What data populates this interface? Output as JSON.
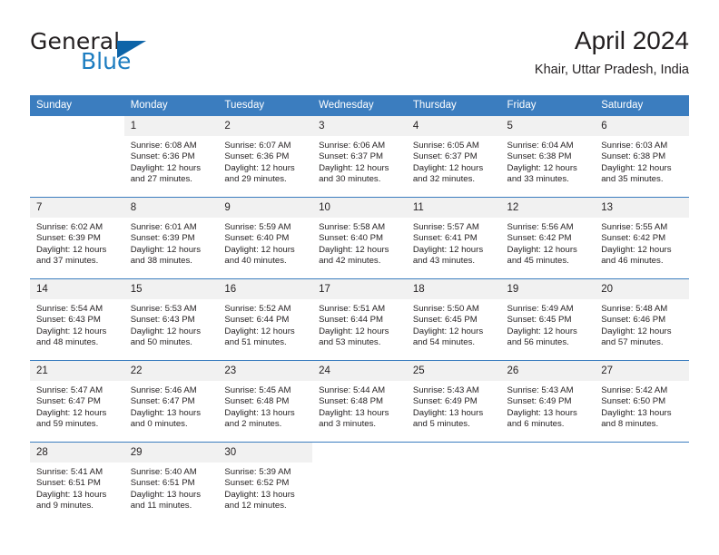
{
  "brand": {
    "name_part1": "General",
    "name_part2": "Blue",
    "triangle_color": "#0d64a8",
    "blue_color": "#1c7cc0"
  },
  "header": {
    "title": "April 2024",
    "subtitle": "Khair, Uttar Pradesh, India"
  },
  "theme": {
    "header_bg": "#3b7dbf",
    "header_text": "#ffffff",
    "daynum_bg": "#f1f1f1",
    "cell_bg": "#ffffff",
    "text": "#231f20"
  },
  "calendar": {
    "weekdays": [
      "Sunday",
      "Monday",
      "Tuesday",
      "Wednesday",
      "Thursday",
      "Friday",
      "Saturday"
    ],
    "weeks": [
      [
        {
          "blank": true
        },
        {
          "day": "1",
          "sunrise": "Sunrise: 6:08 AM",
          "sunset": "Sunset: 6:36 PM",
          "daylight_line1": "Daylight: 12 hours",
          "daylight_line2": "and 27 minutes."
        },
        {
          "day": "2",
          "sunrise": "Sunrise: 6:07 AM",
          "sunset": "Sunset: 6:36 PM",
          "daylight_line1": "Daylight: 12 hours",
          "daylight_line2": "and 29 minutes."
        },
        {
          "day": "3",
          "sunrise": "Sunrise: 6:06 AM",
          "sunset": "Sunset: 6:37 PM",
          "daylight_line1": "Daylight: 12 hours",
          "daylight_line2": "and 30 minutes."
        },
        {
          "day": "4",
          "sunrise": "Sunrise: 6:05 AM",
          "sunset": "Sunset: 6:37 PM",
          "daylight_line1": "Daylight: 12 hours",
          "daylight_line2": "and 32 minutes."
        },
        {
          "day": "5",
          "sunrise": "Sunrise: 6:04 AM",
          "sunset": "Sunset: 6:38 PM",
          "daylight_line1": "Daylight: 12 hours",
          "daylight_line2": "and 33 minutes."
        },
        {
          "day": "6",
          "sunrise": "Sunrise: 6:03 AM",
          "sunset": "Sunset: 6:38 PM",
          "daylight_line1": "Daylight: 12 hours",
          "daylight_line2": "and 35 minutes."
        }
      ],
      [
        {
          "day": "7",
          "sunrise": "Sunrise: 6:02 AM",
          "sunset": "Sunset: 6:39 PM",
          "daylight_line1": "Daylight: 12 hours",
          "daylight_line2": "and 37 minutes."
        },
        {
          "day": "8",
          "sunrise": "Sunrise: 6:01 AM",
          "sunset": "Sunset: 6:39 PM",
          "daylight_line1": "Daylight: 12 hours",
          "daylight_line2": "and 38 minutes."
        },
        {
          "day": "9",
          "sunrise": "Sunrise: 5:59 AM",
          "sunset": "Sunset: 6:40 PM",
          "daylight_line1": "Daylight: 12 hours",
          "daylight_line2": "and 40 minutes."
        },
        {
          "day": "10",
          "sunrise": "Sunrise: 5:58 AM",
          "sunset": "Sunset: 6:40 PM",
          "daylight_line1": "Daylight: 12 hours",
          "daylight_line2": "and 42 minutes."
        },
        {
          "day": "11",
          "sunrise": "Sunrise: 5:57 AM",
          "sunset": "Sunset: 6:41 PM",
          "daylight_line1": "Daylight: 12 hours",
          "daylight_line2": "and 43 minutes."
        },
        {
          "day": "12",
          "sunrise": "Sunrise: 5:56 AM",
          "sunset": "Sunset: 6:42 PM",
          "daylight_line1": "Daylight: 12 hours",
          "daylight_line2": "and 45 minutes."
        },
        {
          "day": "13",
          "sunrise": "Sunrise: 5:55 AM",
          "sunset": "Sunset: 6:42 PM",
          "daylight_line1": "Daylight: 12 hours",
          "daylight_line2": "and 46 minutes."
        }
      ],
      [
        {
          "day": "14",
          "sunrise": "Sunrise: 5:54 AM",
          "sunset": "Sunset: 6:43 PM",
          "daylight_line1": "Daylight: 12 hours",
          "daylight_line2": "and 48 minutes."
        },
        {
          "day": "15",
          "sunrise": "Sunrise: 5:53 AM",
          "sunset": "Sunset: 6:43 PM",
          "daylight_line1": "Daylight: 12 hours",
          "daylight_line2": "and 50 minutes."
        },
        {
          "day": "16",
          "sunrise": "Sunrise: 5:52 AM",
          "sunset": "Sunset: 6:44 PM",
          "daylight_line1": "Daylight: 12 hours",
          "daylight_line2": "and 51 minutes."
        },
        {
          "day": "17",
          "sunrise": "Sunrise: 5:51 AM",
          "sunset": "Sunset: 6:44 PM",
          "daylight_line1": "Daylight: 12 hours",
          "daylight_line2": "and 53 minutes."
        },
        {
          "day": "18",
          "sunrise": "Sunrise: 5:50 AM",
          "sunset": "Sunset: 6:45 PM",
          "daylight_line1": "Daylight: 12 hours",
          "daylight_line2": "and 54 minutes."
        },
        {
          "day": "19",
          "sunrise": "Sunrise: 5:49 AM",
          "sunset": "Sunset: 6:45 PM",
          "daylight_line1": "Daylight: 12 hours",
          "daylight_line2": "and 56 minutes."
        },
        {
          "day": "20",
          "sunrise": "Sunrise: 5:48 AM",
          "sunset": "Sunset: 6:46 PM",
          "daylight_line1": "Daylight: 12 hours",
          "daylight_line2": "and 57 minutes."
        }
      ],
      [
        {
          "day": "21",
          "sunrise": "Sunrise: 5:47 AM",
          "sunset": "Sunset: 6:47 PM",
          "daylight_line1": "Daylight: 12 hours",
          "daylight_line2": "and 59 minutes."
        },
        {
          "day": "22",
          "sunrise": "Sunrise: 5:46 AM",
          "sunset": "Sunset: 6:47 PM",
          "daylight_line1": "Daylight: 13 hours",
          "daylight_line2": "and 0 minutes."
        },
        {
          "day": "23",
          "sunrise": "Sunrise: 5:45 AM",
          "sunset": "Sunset: 6:48 PM",
          "daylight_line1": "Daylight: 13 hours",
          "daylight_line2": "and 2 minutes."
        },
        {
          "day": "24",
          "sunrise": "Sunrise: 5:44 AM",
          "sunset": "Sunset: 6:48 PM",
          "daylight_line1": "Daylight: 13 hours",
          "daylight_line2": "and 3 minutes."
        },
        {
          "day": "25",
          "sunrise": "Sunrise: 5:43 AM",
          "sunset": "Sunset: 6:49 PM",
          "daylight_line1": "Daylight: 13 hours",
          "daylight_line2": "and 5 minutes."
        },
        {
          "day": "26",
          "sunrise": "Sunrise: 5:43 AM",
          "sunset": "Sunset: 6:49 PM",
          "daylight_line1": "Daylight: 13 hours",
          "daylight_line2": "and 6 minutes."
        },
        {
          "day": "27",
          "sunrise": "Sunrise: 5:42 AM",
          "sunset": "Sunset: 6:50 PM",
          "daylight_line1": "Daylight: 13 hours",
          "daylight_line2": "and 8 minutes."
        }
      ],
      [
        {
          "day": "28",
          "sunrise": "Sunrise: 5:41 AM",
          "sunset": "Sunset: 6:51 PM",
          "daylight_line1": "Daylight: 13 hours",
          "daylight_line2": "and 9 minutes."
        },
        {
          "day": "29",
          "sunrise": "Sunrise: 5:40 AM",
          "sunset": "Sunset: 6:51 PM",
          "daylight_line1": "Daylight: 13 hours",
          "daylight_line2": "and 11 minutes."
        },
        {
          "day": "30",
          "sunrise": "Sunrise: 5:39 AM",
          "sunset": "Sunset: 6:52 PM",
          "daylight_line1": "Daylight: 13 hours",
          "daylight_line2": "and 12 minutes."
        },
        {
          "blank": true
        },
        {
          "blank": true
        },
        {
          "blank": true
        },
        {
          "blank": true
        }
      ]
    ]
  }
}
